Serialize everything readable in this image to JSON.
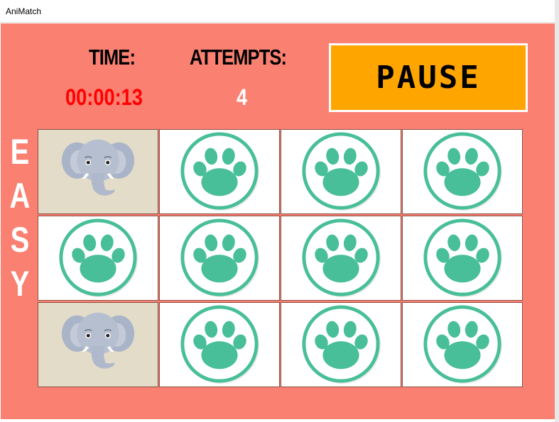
{
  "window": {
    "title": "AniMatch"
  },
  "hud": {
    "time_label": "TIME:",
    "time_value": "00:00:13",
    "attempts_label": "ATTEMPTS:",
    "attempts_value": "4",
    "pause_label": "PAUSE"
  },
  "difficulty": {
    "letters": [
      "E",
      "A",
      "S",
      "Y"
    ]
  },
  "board": {
    "rows": 3,
    "cols": 4,
    "cards": [
      {
        "state": "face",
        "animal": "elephant"
      },
      {
        "state": "back",
        "icon": "paw-icon"
      },
      {
        "state": "back",
        "icon": "paw-icon"
      },
      {
        "state": "back",
        "icon": "paw-icon"
      },
      {
        "state": "back",
        "icon": "paw-icon"
      },
      {
        "state": "back",
        "icon": "paw-icon"
      },
      {
        "state": "back",
        "icon": "paw-icon"
      },
      {
        "state": "back",
        "icon": "paw-icon"
      },
      {
        "state": "face",
        "animal": "elephant"
      },
      {
        "state": "back",
        "icon": "paw-icon"
      },
      {
        "state": "back",
        "icon": "paw-icon"
      },
      {
        "state": "back",
        "icon": "paw-icon"
      }
    ]
  },
  "colors": {
    "background": "#fa8072",
    "time_value": "#ff0000",
    "attempts_value": "#ffffff",
    "pause_button": "#ffa500",
    "paw": "#48bf98",
    "card_face": "#e3dcc8"
  }
}
